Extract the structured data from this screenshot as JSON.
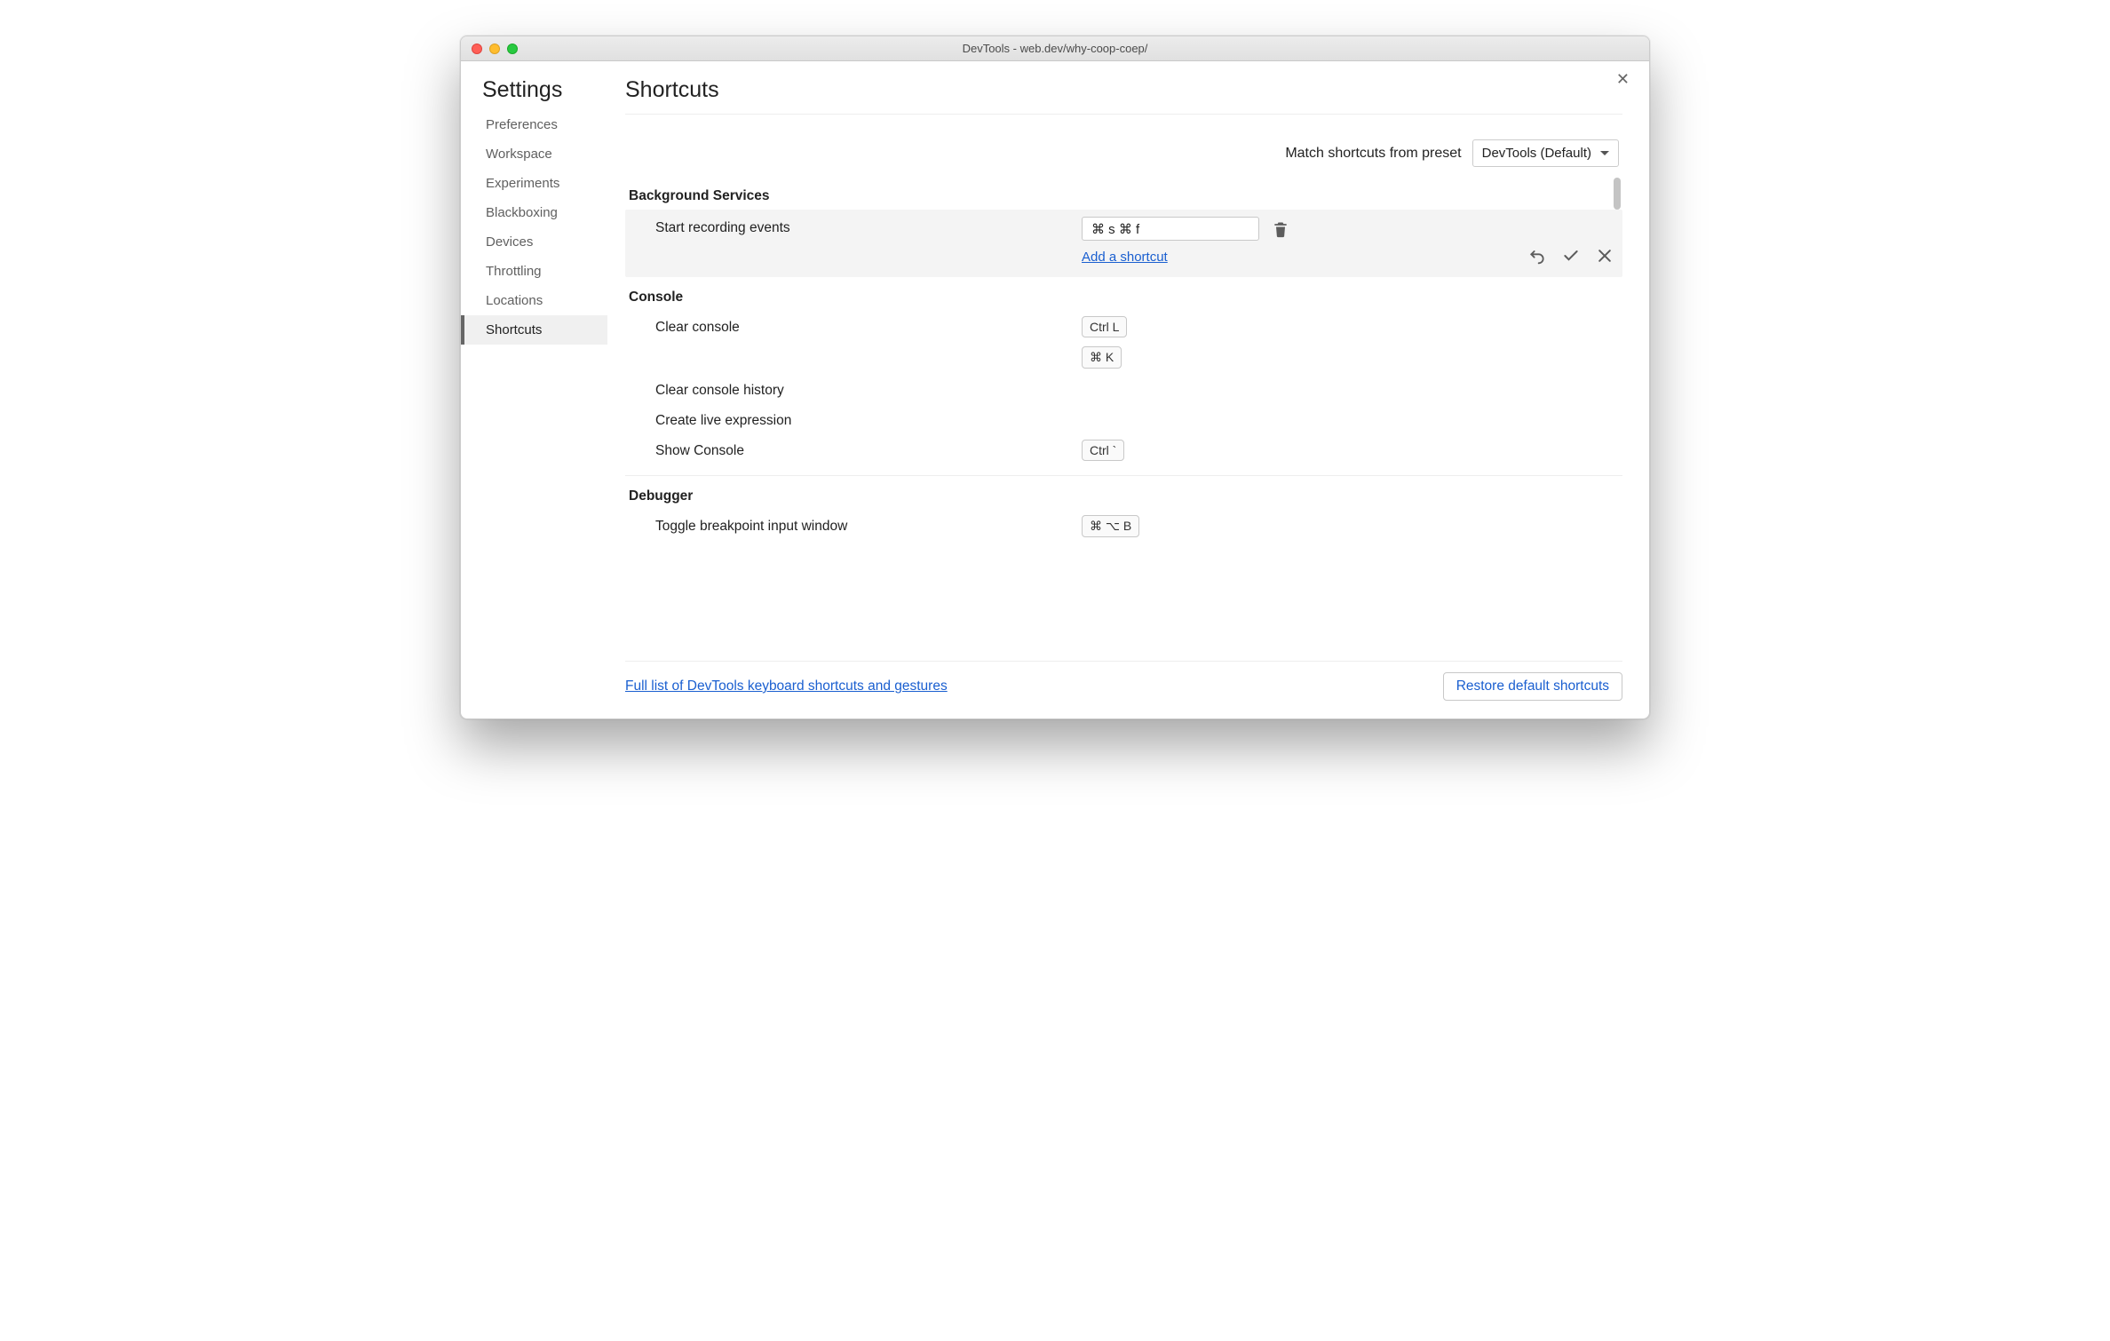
{
  "window": {
    "title": "DevTools - web.dev/why-coop-coep/"
  },
  "sidebar": {
    "title": "Settings",
    "items": [
      {
        "label": "Preferences"
      },
      {
        "label": "Workspace"
      },
      {
        "label": "Experiments"
      },
      {
        "label": "Blackboxing"
      },
      {
        "label": "Devices"
      },
      {
        "label": "Throttling"
      },
      {
        "label": "Locations"
      },
      {
        "label": "Shortcuts",
        "active": true
      }
    ]
  },
  "page": {
    "title": "Shortcuts",
    "preset_label": "Match shortcuts from preset",
    "preset_value": "DevTools (Default)"
  },
  "sections": {
    "background": {
      "heading": "Background Services",
      "start_recording": {
        "label": "Start recording events",
        "input_value": "⌘ s ⌘ f",
        "add_link": "Add a shortcut"
      }
    },
    "console": {
      "heading": "Console",
      "clear_console": {
        "label": "Clear console",
        "keys": [
          "Ctrl L",
          "⌘ K"
        ]
      },
      "clear_history": {
        "label": "Clear console history"
      },
      "create_live": {
        "label": "Create live expression"
      },
      "show_console": {
        "label": "Show Console",
        "keys": [
          "Ctrl `"
        ]
      }
    },
    "debugger": {
      "heading": "Debugger",
      "toggle_bp": {
        "label": "Toggle breakpoint input window",
        "keys": [
          "⌘ ⌥ B"
        ]
      }
    }
  },
  "footer": {
    "link": "Full list of DevTools keyboard shortcuts and gestures",
    "restore": "Restore default shortcuts"
  }
}
